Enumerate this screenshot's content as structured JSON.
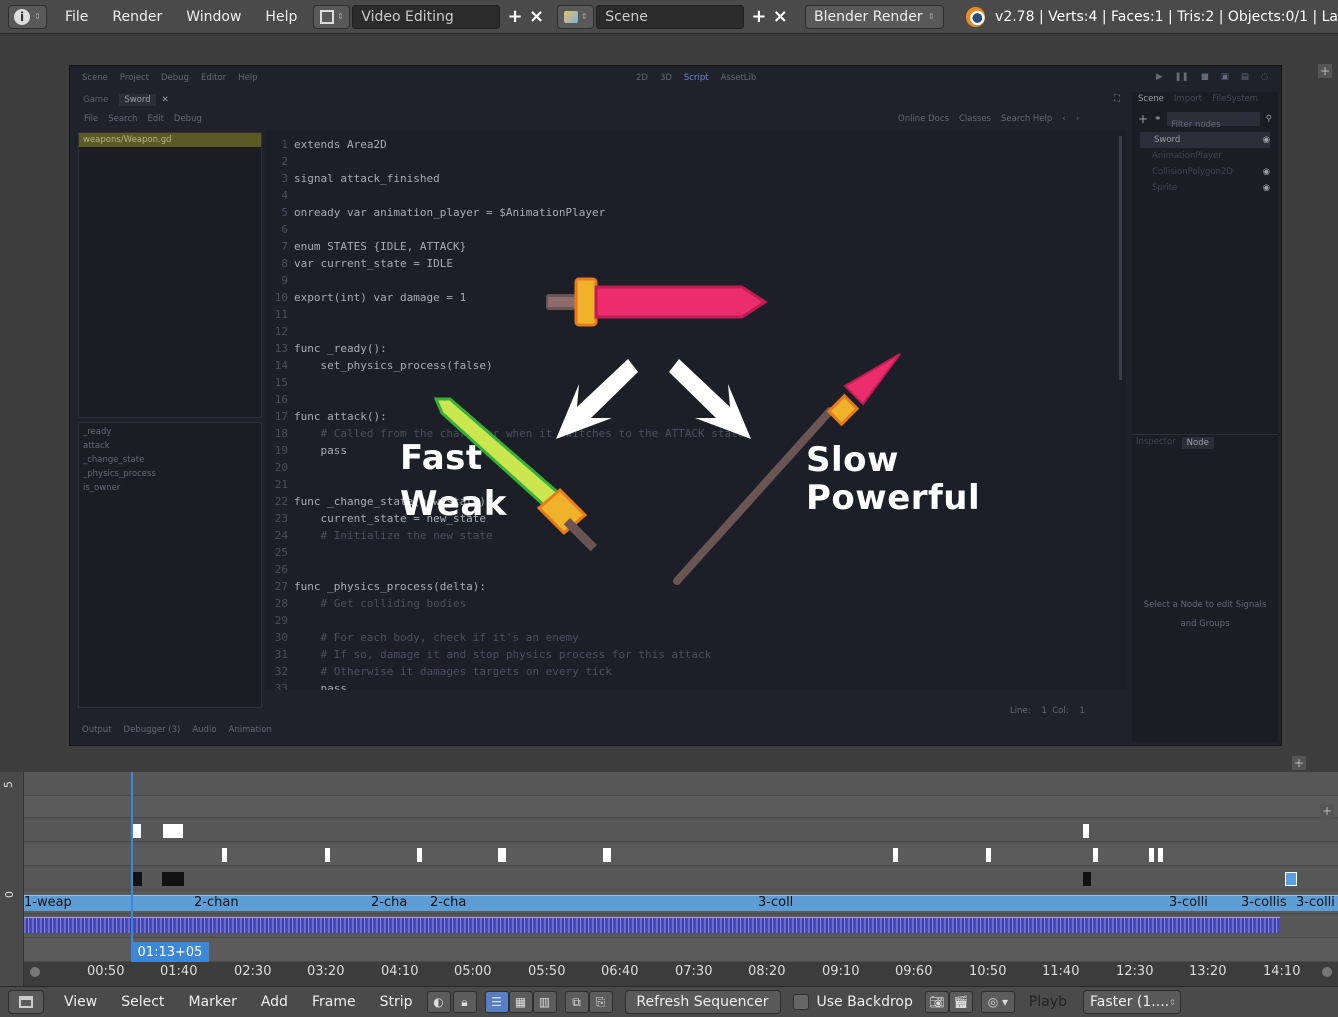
{
  "topbar": {
    "info_icon": "info-icon",
    "menus": [
      "File",
      "Render",
      "Window",
      "Help"
    ],
    "layout_name": "Video Editing",
    "scene_name": "Scene",
    "render_engine": "Blender Render",
    "stats": "v2.78 | Verts:4 | Faces:1 | Tris:2 | Objects:0/1 | La"
  },
  "godot": {
    "menubar": [
      "Scene",
      "Project",
      "Debug",
      "Editor",
      "Help"
    ],
    "workspace": [
      "2D",
      "3D",
      "Script",
      "AssetLib"
    ],
    "tabs": [
      "Game",
      "Sword"
    ],
    "script_menu": [
      "File",
      "Search",
      "Edit",
      "Debug"
    ],
    "doc_links": [
      "Online Docs",
      "Classes",
      "Search Help"
    ],
    "open_file": "weapons/Weapon.gd",
    "methods": [
      "_ready",
      "attack",
      "_change_state",
      "_physics_process",
      "is_owner"
    ],
    "code_lines": [
      {
        "n": "1",
        "t": "extends Area2D"
      },
      {
        "n": "2",
        "t": ""
      },
      {
        "n": "3",
        "t": "signal attack_finished"
      },
      {
        "n": "4",
        "t": ""
      },
      {
        "n": "5",
        "t": "onready var animation_player = $AnimationPlayer"
      },
      {
        "n": "6",
        "t": ""
      },
      {
        "n": "7",
        "t": "enum STATES {IDLE, ATTACK}"
      },
      {
        "n": "8",
        "t": "var current_state = IDLE"
      },
      {
        "n": "9",
        "t": ""
      },
      {
        "n": "10",
        "t": "export(int) var damage = 1"
      },
      {
        "n": "11",
        "t": ""
      },
      {
        "n": "12",
        "t": ""
      },
      {
        "n": "13",
        "t": "func _ready():"
      },
      {
        "n": "14",
        "t": "    set_physics_process(false)"
      },
      {
        "n": "15",
        "t": ""
      },
      {
        "n": "16",
        "t": ""
      },
      {
        "n": "17",
        "t": "func attack():"
      },
      {
        "n": "18",
        "t": "    # Called from the character when it switches to the ATTACK state"
      },
      {
        "n": "19",
        "t": "    pass"
      },
      {
        "n": "20",
        "t": ""
      },
      {
        "n": "21",
        "t": ""
      },
      {
        "n": "22",
        "t": "func _change_state(new_state):"
      },
      {
        "n": "23",
        "t": "    current_state = new_state"
      },
      {
        "n": "24",
        "t": "    # Initialize the new state"
      },
      {
        "n": "25",
        "t": ""
      },
      {
        "n": "26",
        "t": ""
      },
      {
        "n": "27",
        "t": "func _physics_process(delta):"
      },
      {
        "n": "28",
        "t": "    # Get colliding bodies"
      },
      {
        "n": "29",
        "t": ""
      },
      {
        "n": "30",
        "t": "    # For each body, check if it's an enemy"
      },
      {
        "n": "31",
        "t": "    # If so, damage it and stop physics process for this attack"
      },
      {
        "n": "32",
        "t": "    # Otherwise it damages targets on every tick"
      },
      {
        "n": "33",
        "t": "    pass"
      }
    ],
    "status": "Line:    1  Col:    1",
    "scene_tabs": [
      "Scene",
      "Import",
      "FileSystem"
    ],
    "filter_placeholder": "Filter nodes",
    "tree": [
      "Sword",
      "AnimationPlayer",
      "CollisionPolygon2D",
      "Sprite"
    ],
    "inspector_tabs": [
      "Inspector",
      "Node"
    ],
    "node_hint": "Select a Node to edit Signals and Groups",
    "bottom_tabs": [
      "Output",
      "Debugger (3)",
      "Audio",
      "Animation"
    ]
  },
  "overlay": {
    "left_line1": "Fast",
    "left_line2": "Weak",
    "right_line1": "Slow",
    "right_line2": "Powerful"
  },
  "sequencer": {
    "channel_left_top": "5",
    "channel_left_bottom": "0",
    "current_time": "01:13+05",
    "strip_labels": [
      "1-weap",
      "2-chan",
      "2-cha",
      "2-cha",
      "3-coll",
      "3-colli",
      "3-collis",
      "3-colli"
    ],
    "ticks": [
      "00:50",
      "01:40",
      "02:30",
      "03:20",
      "04:10",
      "05:00",
      "05:50",
      "06:40",
      "07:30",
      "08:20",
      "09:10",
      "09:60",
      "10:50",
      "11:40",
      "12:30",
      "13:20",
      "14:10"
    ]
  },
  "bottombar": {
    "menus": [
      "View",
      "Select",
      "Marker",
      "Add",
      "Frame",
      "Strip"
    ],
    "refresh": "Refresh Sequencer",
    "backdrop": "Use Backdrop",
    "playback": "Playb",
    "speed": "Faster (1...."
  }
}
